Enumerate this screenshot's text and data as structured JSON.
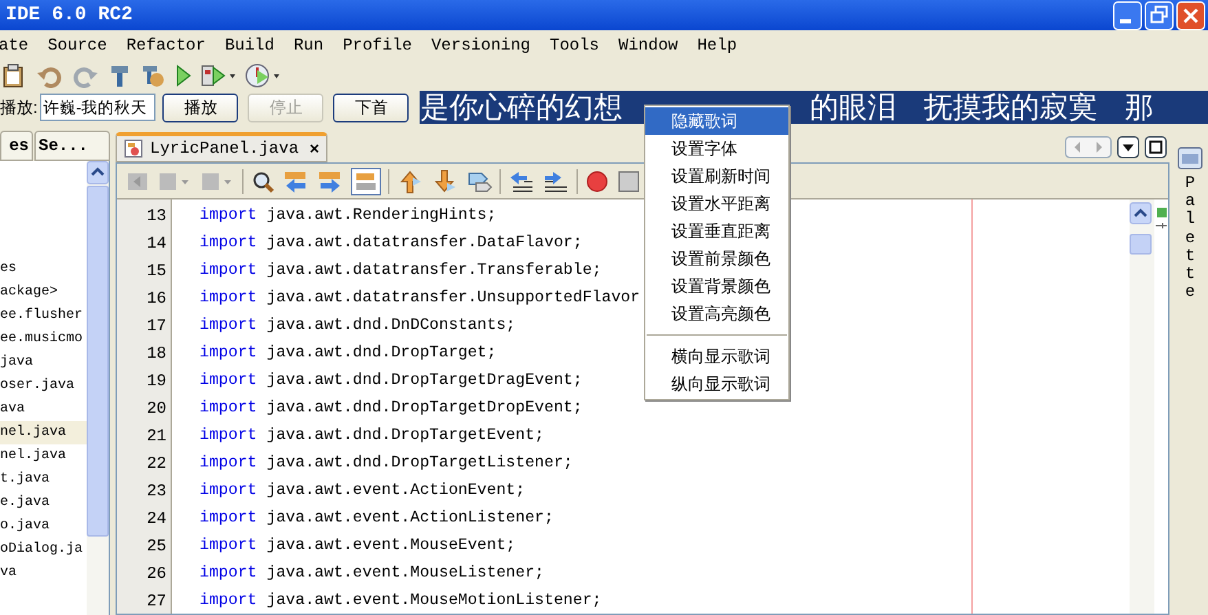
{
  "window": {
    "title": "IDE 6.0 RC2"
  },
  "menu_bar": [
    "ate",
    "Source",
    "Refactor",
    "Build",
    "Run",
    "Profile",
    "Versioning",
    "Tools",
    "Window",
    "Help"
  ],
  "player": {
    "label": "播放:",
    "song": "许巍-我的秋天",
    "buttons": [
      {
        "label": "播放",
        "disabled": false
      },
      {
        "label": "停止",
        "disabled": true
      },
      {
        "label": "下首",
        "disabled": false
      }
    ],
    "lyric": [
      "是你心碎的幻想",
      "的眼泪",
      "抚摸我的寂寞",
      "那"
    ]
  },
  "projects_panel": {
    "tabs": [
      {
        "label": "es",
        "selected": false
      },
      {
        "label": "Se...",
        "selected": false
      }
    ],
    "items": [
      {
        "label": "es",
        "selected": false
      },
      {
        "label": "ackage>",
        "selected": false
      },
      {
        "label": "ee.flusher",
        "selected": false
      },
      {
        "label": "ee.musicmo",
        "selected": false
      },
      {
        "label": "java",
        "selected": false
      },
      {
        "label": "oser.java",
        "selected": false
      },
      {
        "label": "ava",
        "selected": false
      },
      {
        "label": "nel.java",
        "selected": true
      },
      {
        "label": "nel.java",
        "selected": false
      },
      {
        "label": "t.java",
        "selected": false
      },
      {
        "label": "e.java",
        "selected": false
      },
      {
        "label": "o.java",
        "selected": false
      },
      {
        "label": "oDialog.ja",
        "selected": false
      },
      {
        "label": "va",
        "selected": false
      }
    ]
  },
  "editor": {
    "tab": {
      "label": "LyricPanel.java",
      "close": "×"
    },
    "lines": [
      {
        "number": "13",
        "keyword": "import",
        "text": "java.awt.RenderingHints;"
      },
      {
        "number": "14",
        "keyword": "import",
        "text": "java.awt.datatransfer.DataFlavor;"
      },
      {
        "number": "15",
        "keyword": "import",
        "text": "java.awt.datatransfer.Transferable;"
      },
      {
        "number": "16",
        "keyword": "import",
        "text": "java.awt.datatransfer.UnsupportedFlavor"
      },
      {
        "number": "17",
        "keyword": "import",
        "text": "java.awt.dnd.DnDConstants;"
      },
      {
        "number": "18",
        "keyword": "import",
        "text": "java.awt.dnd.DropTarget;"
      },
      {
        "number": "19",
        "keyword": "import",
        "text": "java.awt.dnd.DropTargetDragEvent;"
      },
      {
        "number": "20",
        "keyword": "import",
        "text": "java.awt.dnd.DropTargetDropEvent;"
      },
      {
        "number": "21",
        "keyword": "import",
        "text": "java.awt.dnd.DropTargetEvent;"
      },
      {
        "number": "22",
        "keyword": "import",
        "text": "java.awt.dnd.DropTargetListener;"
      },
      {
        "number": "23",
        "keyword": "import",
        "text": "java.awt.event.ActionEvent;"
      },
      {
        "number": "24",
        "keyword": "import",
        "text": "java.awt.event.ActionListener;"
      },
      {
        "number": "25",
        "keyword": "import",
        "text": "java.awt.event.MouseEvent;"
      },
      {
        "number": "26",
        "keyword": "import",
        "text": "java.awt.event.MouseListener;"
      },
      {
        "number": "27",
        "keyword": "import",
        "text": "java.awt.event.MouseMotionListener;"
      }
    ]
  },
  "palette": {
    "label": "Palette"
  },
  "context_menu": [
    {
      "label": "隐藏歌词",
      "selected": true,
      "kind": "item"
    },
    {
      "label": "设置字体",
      "selected": false,
      "kind": "item"
    },
    {
      "label": "设置刷新时间",
      "selected": false,
      "kind": "item"
    },
    {
      "label": "设置水平距离",
      "selected": false,
      "kind": "item"
    },
    {
      "label": "设置垂直距离",
      "selected": false,
      "kind": "item"
    },
    {
      "label": "设置前景颜色",
      "selected": false,
      "kind": "item"
    },
    {
      "label": "设置背景颜色",
      "selected": false,
      "kind": "item"
    },
    {
      "label": "设置高亮颜色",
      "selected": false,
      "kind": "item"
    },
    {
      "kind": "separator"
    },
    {
      "label": "横向显示歌词",
      "selected": false,
      "kind": "item"
    },
    {
      "label": "纵向显示歌词",
      "selected": false,
      "kind": "item"
    }
  ]
}
